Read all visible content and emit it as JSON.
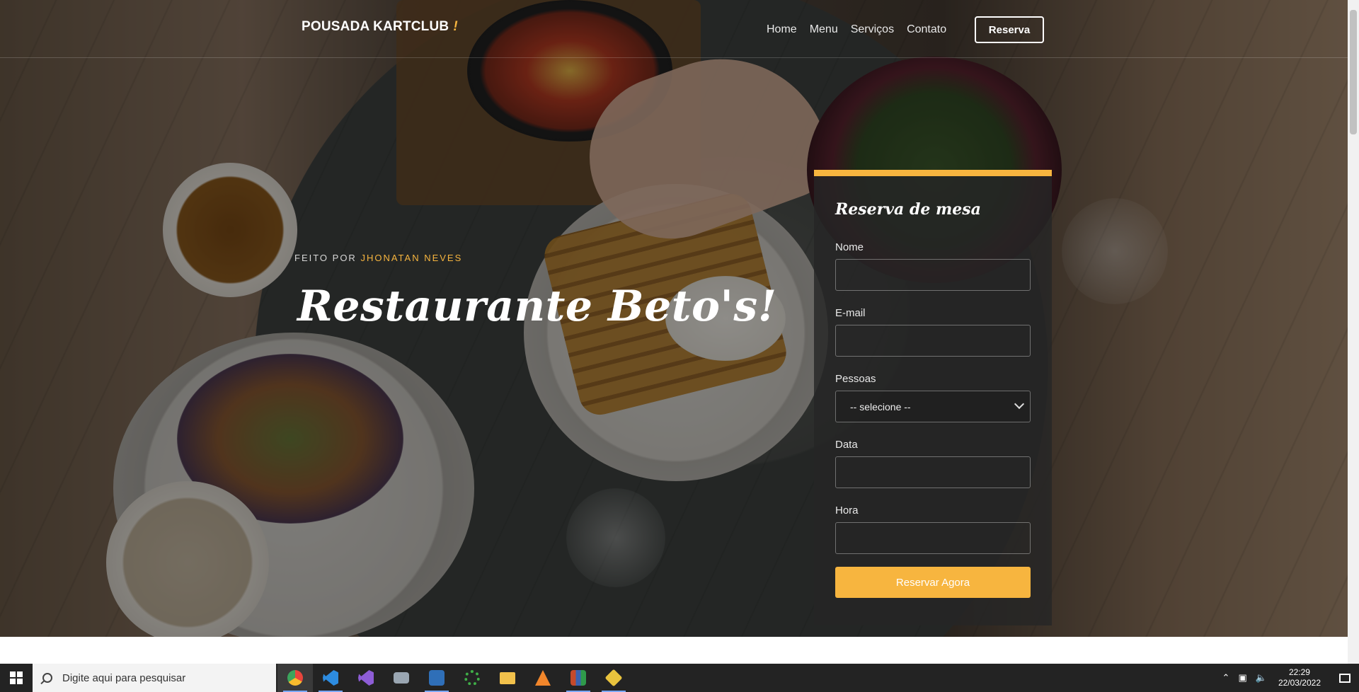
{
  "navbar": {
    "brand": "POUSADA KARTCLUB",
    "brand_accent": "!",
    "links": [
      "Home",
      "Menu",
      "Serviços",
      "Contato"
    ],
    "reserve_label": "Reserva"
  },
  "hero": {
    "byline_prefix": "FEITO POR",
    "byline_author": "JHONATAN NEVES",
    "title": "Restaurante Beto's!"
  },
  "form": {
    "title": "Reserva de mesa",
    "fields": [
      {
        "label": "Nome",
        "value": ""
      },
      {
        "label": "E-mail",
        "value": ""
      },
      {
        "label": "Pessoas",
        "selected": "-- selecione --"
      },
      {
        "label": "Data",
        "value": ""
      },
      {
        "label": "Hora",
        "value": ""
      }
    ],
    "submit_label": "Reservar Agora"
  },
  "taskbar": {
    "search_placeholder": "Digite aqui para pesquisar",
    "apps": [
      {
        "name": "chrome-icon",
        "color": "#e8453c"
      },
      {
        "name": "vscode-icon",
        "color": "#2d8ce0"
      },
      {
        "name": "visual-studio-icon",
        "color": "#8e5dd6"
      },
      {
        "name": "monitor-app-icon",
        "color": "#9aa6b2"
      },
      {
        "name": "app-icon-blue",
        "color": "#2f6fb8"
      },
      {
        "name": "refresh-app-icon",
        "color": "#3fae47"
      },
      {
        "name": "file-explorer-icon",
        "color": "#f2c14b"
      },
      {
        "name": "sublime-icon",
        "color": "#f2862b"
      },
      {
        "name": "archive-app-icon",
        "color": "#c44a2b"
      },
      {
        "name": "git-app-icon",
        "color": "#e9c33d"
      }
    ],
    "time": "22:29",
    "date": "22/03/2022"
  },
  "colors": {
    "accent": "#f7b53f",
    "form_bg": "#262626",
    "taskbar_bg": "#232323"
  }
}
